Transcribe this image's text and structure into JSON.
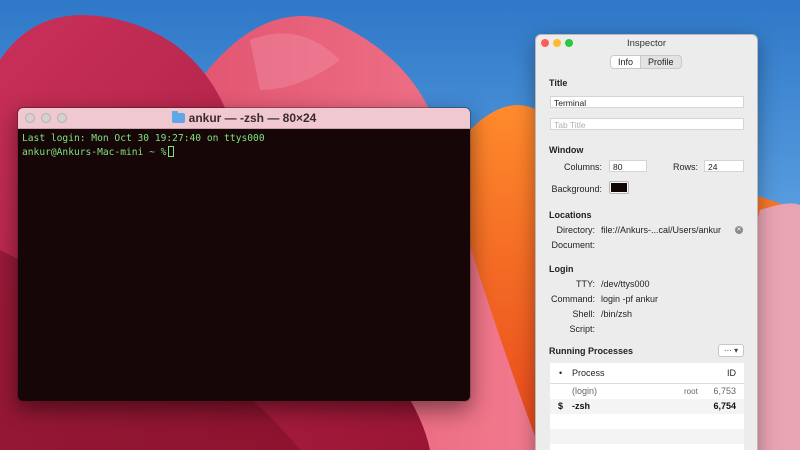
{
  "terminal": {
    "title": "ankur — -zsh — 80×24",
    "lines": [
      "Last login: Mon Oct 30 19:27:40 on ttys000",
      "ankur@Ankurs-Mac-mini ~ %"
    ]
  },
  "inspector": {
    "title": "Inspector",
    "tabs": [
      "Info",
      "Profile"
    ],
    "sections": {
      "title": "Title",
      "window": "Window",
      "locations": "Locations",
      "login": "Login",
      "processes": "Running Processes"
    },
    "title_field": {
      "value": "Terminal"
    },
    "tab_title_field": {
      "placeholder": "Tab Title"
    },
    "window": {
      "columns_label": "Columns:",
      "columns": "80",
      "rows_label": "Rows:",
      "rows": "24",
      "background_label": "Background:"
    },
    "locations": {
      "directory_label": "Directory:",
      "directory": "file://Ankurs-...cal/Users/ankur",
      "document_label": "Document:"
    },
    "login": {
      "tty_label": "TTY:",
      "tty": "/dev/ttys000",
      "command_label": "Command:",
      "command": "login -pf ankur",
      "shell_label": "Shell:",
      "shell": "/bin/zsh",
      "script_label": "Script:"
    },
    "processes": {
      "headers": {
        "marker": "•",
        "process": "Process",
        "id": "ID"
      },
      "rows": [
        {
          "marker": "",
          "process": "(login)",
          "user": "root",
          "id": "6,753"
        },
        {
          "marker": "$",
          "process": "-zsh",
          "user": "",
          "id": "6,754"
        }
      ]
    }
  },
  "colors": {
    "terminal_text": "#7fe37f",
    "terminal_bg": "#170607"
  }
}
